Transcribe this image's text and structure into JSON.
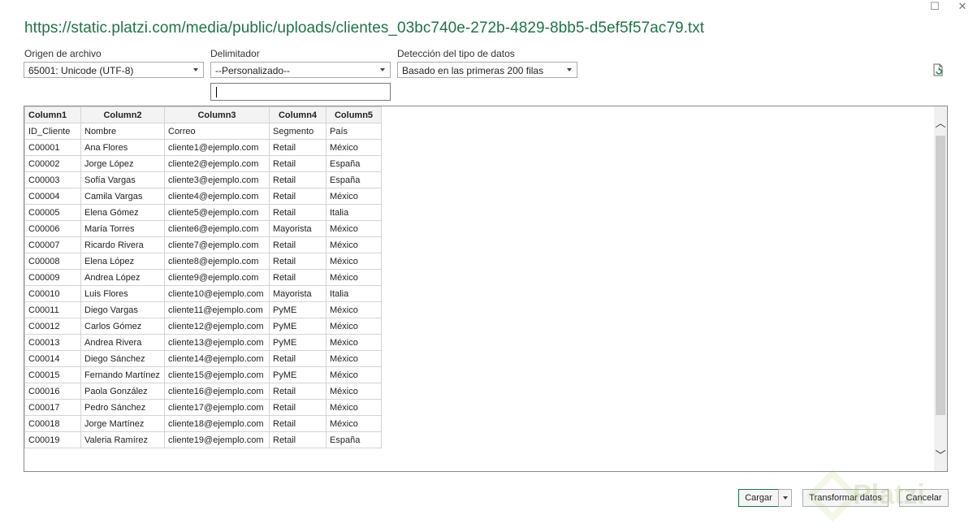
{
  "window": {
    "title": "https://static.platzi.com/media/public/uploads/clientes_03bc740e-272b-4829-8bb5-d5ef5f57ac79.txt"
  },
  "options": {
    "origin_label": "Origen de archivo",
    "origin_value": "65001: Unicode (UTF-8)",
    "delimiter_label": "Delimitador",
    "delimiter_value": "--Personalizado--",
    "delimiter_custom_value": "",
    "detection_label": "Detección del tipo de datos",
    "detection_value": "Basado en las primeras 200 filas"
  },
  "preview": {
    "columns": [
      "Column1",
      "Column2",
      "Column3",
      "Column4",
      "Column5"
    ],
    "rows": [
      [
        "ID_Cliente",
        "Nombre",
        "Correo",
        "Segmento",
        "País"
      ],
      [
        "C00001",
        "Ana Flores",
        "cliente1@ejemplo.com",
        "Retail",
        "México"
      ],
      [
        "C00002",
        "Jorge López",
        "cliente2@ejemplo.com",
        "Retail",
        "España"
      ],
      [
        "C00003",
        "Sofía Vargas",
        "cliente3@ejemplo.com",
        "Retail",
        "España"
      ],
      [
        "C00004",
        "Camila Vargas",
        "cliente4@ejemplo.com",
        "Retail",
        "México"
      ],
      [
        "C00005",
        "Elena Gómez",
        "cliente5@ejemplo.com",
        "Retail",
        "Italia"
      ],
      [
        "C00006",
        "María Torres",
        "cliente6@ejemplo.com",
        "Mayorista",
        "México"
      ],
      [
        "C00007",
        "Ricardo Rivera",
        "cliente7@ejemplo.com",
        "Retail",
        "México"
      ],
      [
        "C00008",
        "Elena López",
        "cliente8@ejemplo.com",
        "Retail",
        "México"
      ],
      [
        "C00009",
        "Andrea López",
        "cliente9@ejemplo.com",
        "Retail",
        "México"
      ],
      [
        "C00010",
        "Luis Flores",
        "cliente10@ejemplo.com",
        "Mayorista",
        "Italia"
      ],
      [
        "C00011",
        "Diego Vargas",
        "cliente11@ejemplo.com",
        "PyME",
        "México"
      ],
      [
        "C00012",
        "Carlos Gómez",
        "cliente12@ejemplo.com",
        "PyME",
        "México"
      ],
      [
        "C00013",
        "Andrea Rivera",
        "cliente13@ejemplo.com",
        "PyME",
        "México"
      ],
      [
        "C00014",
        "Diego Sánchez",
        "cliente14@ejemplo.com",
        "Retail",
        "México"
      ],
      [
        "C00015",
        "Fernando Martínez",
        "cliente15@ejemplo.com",
        "PyME",
        "México"
      ],
      [
        "C00016",
        "Paola González",
        "cliente16@ejemplo.com",
        "Retail",
        "México"
      ],
      [
        "C00017",
        "Pedro Sánchez",
        "cliente17@ejemplo.com",
        "Retail",
        "México"
      ],
      [
        "C00018",
        "Jorge Martínez",
        "cliente18@ejemplo.com",
        "Retail",
        "México"
      ],
      [
        "C00019",
        "Valeria Ramírez",
        "cliente19@ejemplo.com",
        "Retail",
        "España"
      ]
    ]
  },
  "buttons": {
    "load": "Cargar",
    "transform": "Transformar datos",
    "cancel": "Cancelar"
  },
  "watermark": {
    "text": "Platzi"
  },
  "colors": {
    "accent": "#217346",
    "platzi": "#98ca3f"
  },
  "icons": {
    "refresh": "refresh-file-icon",
    "maximize": "maximize-icon",
    "scroll_up": "chevron-up-icon",
    "scroll_down": "chevron-down-icon"
  }
}
